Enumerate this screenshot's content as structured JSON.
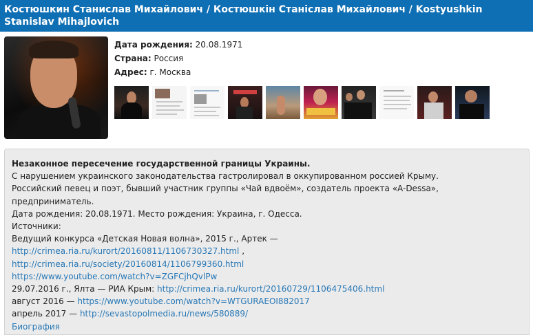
{
  "header": {
    "title": "Костюшкин Станислав Михайлович / Костюшкін Станіслав Михайлович / Kostyushkin Stanislav Mihajlovich"
  },
  "profile": {
    "rows": [
      {
        "label": "Дата рождения:",
        "value": "20.08.1971"
      },
      {
        "label": "Страна:",
        "value": "Россия"
      },
      {
        "label": "Адрес:",
        "value": "г. Москва"
      }
    ],
    "thumbnails": [
      "photo",
      "document",
      "document",
      "photo",
      "photo",
      "poster",
      "photo",
      "document",
      "photo",
      "photo"
    ]
  },
  "details": {
    "title": "Незаконное пересечение государственной границы Украины.",
    "line1": "С нарушением украинского законодательства гастролировал в оккупированном россией Крыму.",
    "line2": "Российский певец и поэт, бывший участник группы «Чай вдвоём», создатель проекта «A-Dessa»,",
    "line3": "предприниматель.",
    "line4": "Дата рождения: 20.08.1971. Место рождения: Украина, г. Одесса.",
    "sources_label": "Источники:",
    "line6": "Ведущий конкурса «Детская Новая волна», 2015 г., Артек —",
    "link1": "http://crimea.ria.ru/kurort/20160811/1106730327.html",
    "link1_tail": " ,",
    "link2": "http://crimea.ria.ru/society/20160814/1106799360.html",
    "link3": "https://www.youtube.com/watch?v=ZGFCjhQvlPw",
    "line10_prefix": "29.07.2016 г., Ялта — РИА Крым: ",
    "link4": "http://crimea.ria.ru/kurort/20160729/1106475406.html",
    "line11_prefix": "август 2016 — ",
    "link5": "https://www.youtube.com/watch?v=WTGURAEOI882017",
    "line12_prefix": "апрель 2017 — ",
    "link6": "http://sevastopolmedia.ru/news/580889/",
    "link7": "Биография"
  },
  "colors": {
    "header_bg": "#0f6fb4",
    "link": "#2878b6",
    "panel_bg": "#ebebeb"
  }
}
